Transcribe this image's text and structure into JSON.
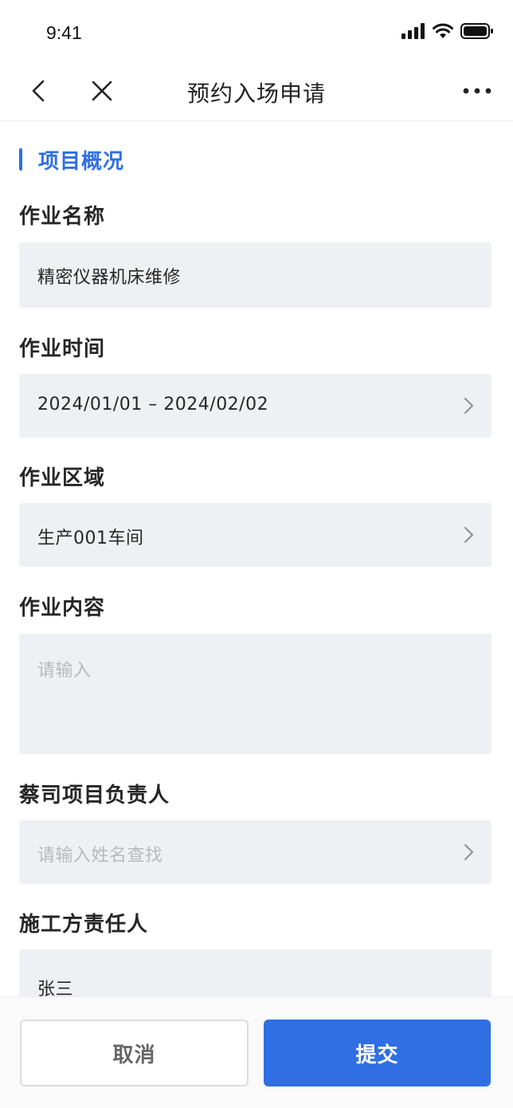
{
  "status_bar": {
    "time": "9:41"
  },
  "nav": {
    "title": "预约入场申请"
  },
  "section": {
    "title": "项目概况"
  },
  "fields": {
    "job_name": {
      "label": "作业名称",
      "value": "精密仪器机床维修"
    },
    "job_time": {
      "label": "作业时间",
      "value": "2024/01/01 – 2024/02/02"
    },
    "job_area": {
      "label": "作业区域",
      "value": "生产001车间"
    },
    "job_content": {
      "label": "作业内容",
      "placeholder": "请输入"
    },
    "project_lead": {
      "label": "蔡司项目负责人",
      "placeholder": "请输入姓名查找"
    },
    "contractor_lead": {
      "label": "施工方责任人",
      "value": "张三"
    }
  },
  "actions": {
    "cancel": "取消",
    "submit": "提交"
  },
  "colors": {
    "accent": "#2f6fe3",
    "field_bg": "#eff0f4",
    "placeholder": "#b7b9bf"
  }
}
